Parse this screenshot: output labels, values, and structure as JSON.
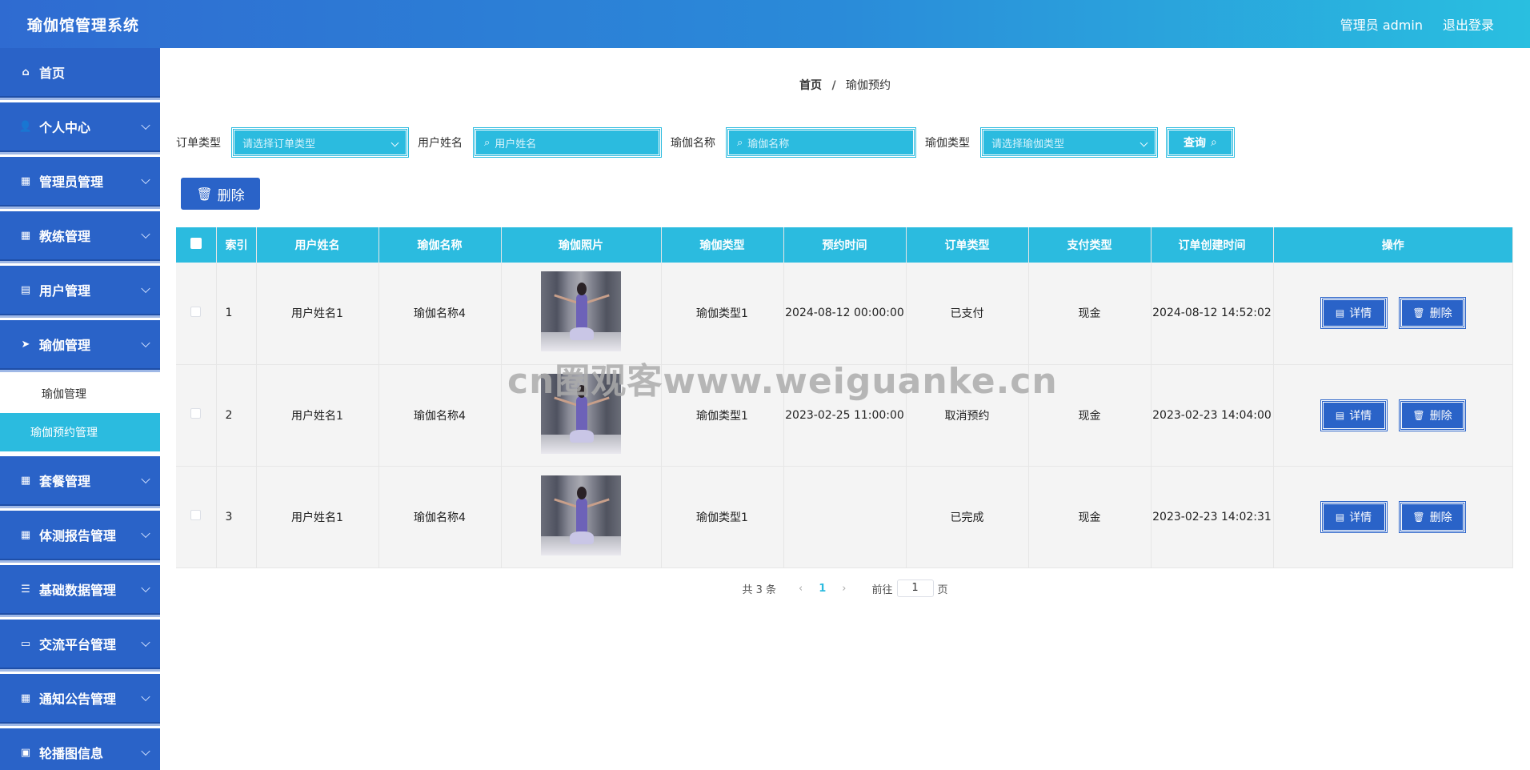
{
  "header": {
    "title": "瑜伽馆管理系统",
    "user_label": "管理员 admin",
    "logout_label": "退出登录"
  },
  "sidebar": {
    "items": [
      {
        "label": "首页",
        "icon": "home-icon",
        "glyph": "⌂"
      },
      {
        "label": "个人中心",
        "icon": "user-icon",
        "glyph": "👤"
      },
      {
        "label": "管理员管理",
        "icon": "grid-icon",
        "glyph": "▦"
      },
      {
        "label": "教练管理",
        "icon": "grid-icon",
        "glyph": "▦"
      },
      {
        "label": "用户管理",
        "icon": "card-icon",
        "glyph": "▤"
      },
      {
        "label": "瑜伽管理",
        "icon": "send-icon",
        "glyph": "➤"
      },
      {
        "label": "套餐管理",
        "icon": "grid-icon",
        "glyph": "▦"
      },
      {
        "label": "体测报告管理",
        "icon": "grid-icon",
        "glyph": "▦"
      },
      {
        "label": "基础数据管理",
        "icon": "sliders-icon",
        "glyph": "☰"
      },
      {
        "label": "交流平台管理",
        "icon": "monitor-icon",
        "glyph": "▭"
      },
      {
        "label": "通知公告管理",
        "icon": "grid-icon",
        "glyph": "▦"
      },
      {
        "label": "轮播图信息",
        "icon": "clipboard-icon",
        "glyph": "▣"
      }
    ],
    "submenu": [
      {
        "label": "瑜伽管理"
      },
      {
        "label": "瑜伽预约管理"
      }
    ]
  },
  "breadcrumb": {
    "home": "首页",
    "separator": "/",
    "current": "瑜伽预约"
  },
  "filters": {
    "order_type_label": "订单类型",
    "order_type_placeholder": "请选择订单类型",
    "user_name_label": "用户姓名",
    "user_name_placeholder": "用户姓名",
    "yoga_name_label": "瑜伽名称",
    "yoga_name_placeholder": "瑜伽名称",
    "yoga_type_label": "瑜伽类型",
    "yoga_type_placeholder": "请选择瑜伽类型",
    "query_label": "查询"
  },
  "toolbar": {
    "delete_label": "删除"
  },
  "table": {
    "headers": [
      "索引",
      "用户姓名",
      "瑜伽名称",
      "瑜伽照片",
      "瑜伽类型",
      "预约时间",
      "订单类型",
      "支付类型",
      "订单创建时间",
      "操作"
    ],
    "rows": [
      {
        "index": "1",
        "user": "用户姓名1",
        "yoga_name": "瑜伽名称4",
        "yoga_type": "瑜伽类型1",
        "appt_time": "2024-08-12 00:00:00",
        "order_type": "已支付",
        "pay_type": "现金",
        "created": "2024-08-12 14:52:02"
      },
      {
        "index": "2",
        "user": "用户姓名1",
        "yoga_name": "瑜伽名称4",
        "yoga_type": "瑜伽类型1",
        "appt_time": "2023-02-25 11:00:00",
        "order_type": "取消预约",
        "pay_type": "现金",
        "created": "2023-02-23 14:04:00"
      },
      {
        "index": "3",
        "user": "用户姓名1",
        "yoga_name": "瑜伽名称4",
        "yoga_type": "瑜伽类型1",
        "appt_time": "",
        "order_type": "已完成",
        "pay_type": "现金",
        "created": "2023-02-23 14:02:31"
      }
    ],
    "detail_label": "详情",
    "delete_label": "删除"
  },
  "pagination": {
    "total": "共 3 条",
    "current_page": "1",
    "goto_label": "前往",
    "goto_value": "1",
    "page_suffix": "页"
  },
  "watermark": "cn圈观客www.weiguanke.cn",
  "colors": {
    "primary": "#2a63c8",
    "accent": "#2bbbdf"
  }
}
